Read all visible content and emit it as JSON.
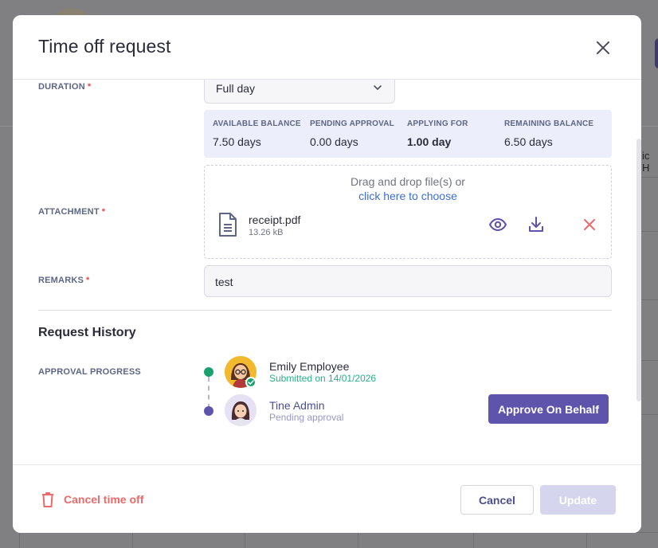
{
  "modal": {
    "title": "Time off request"
  },
  "duration": {
    "label": "DURATION",
    "required_mark": "*",
    "value": "Full day"
  },
  "balance": {
    "columns": [
      {
        "label": "AVAILABLE BALANCE",
        "value": "7.50 days"
      },
      {
        "label": "PENDING APPROVAL",
        "value": "0.00 days"
      },
      {
        "label": "APPLYING FOR",
        "value": "1.00 day"
      },
      {
        "label": "REMAINING BALANCE",
        "value": "6.50 days"
      }
    ]
  },
  "attachment": {
    "label": "ATTACHMENT",
    "required_mark": "*",
    "drop_text": "Drag and drop file(s) or",
    "choose_link": "click here to choose",
    "file": {
      "name": "receipt.pdf",
      "size": "13.26 kB"
    }
  },
  "remarks": {
    "label": "REMARKS",
    "required_mark": "*",
    "value": "test"
  },
  "history": {
    "title": "Request History",
    "progress_label": "APPROVAL PROGRESS",
    "steps": [
      {
        "name": "Emily Employee",
        "status": "Submitted on 14/01/2026",
        "status_color": "#2bb08a"
      },
      {
        "name": "Tine Admin",
        "status": "Pending approval",
        "status_color": "#9a96c8"
      }
    ],
    "approve_button": "Approve On Behalf"
  },
  "footer": {
    "cancel_time_off": "Cancel time off",
    "cancel": "Cancel",
    "update": "Update"
  },
  "background": {
    "partial_text": "ic H"
  },
  "colors": {
    "accent": "#5e54ab",
    "danger": "#ec6a6a",
    "success": "#1aa170",
    "link": "#3b6fd6"
  }
}
